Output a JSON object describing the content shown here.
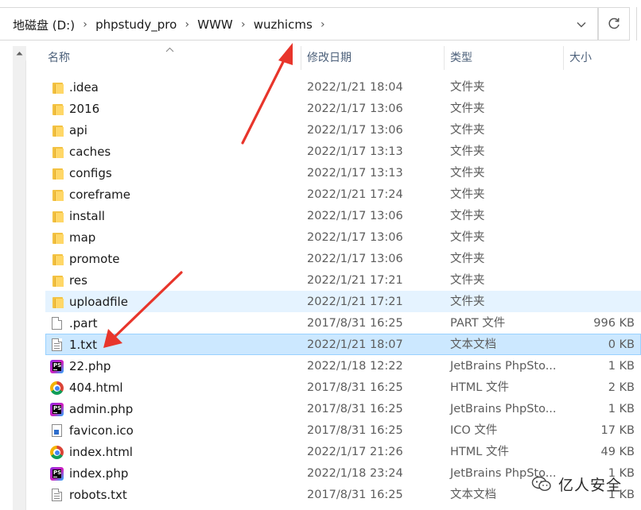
{
  "address_bar": {
    "crumbs": [
      "地磁盘 (D:)",
      "phpstudy_pro",
      "WWW",
      "wuzhicms"
    ],
    "separator": "›",
    "dropdown_icon": "chevron-down-icon",
    "refresh_icon": "refresh-icon"
  },
  "columns": {
    "name": "名称",
    "date": "修改日期",
    "type": "类型",
    "size": "大小"
  },
  "files": [
    {
      "name": ".idea",
      "date": "2022/1/21 18:04",
      "type": "文件夹",
      "size": "",
      "icon": "folder-icon"
    },
    {
      "name": "2016",
      "date": "2022/1/17 13:06",
      "type": "文件夹",
      "size": "",
      "icon": "folder-icon"
    },
    {
      "name": "api",
      "date": "2022/1/17 13:06",
      "type": "文件夹",
      "size": "",
      "icon": "folder-icon"
    },
    {
      "name": "caches",
      "date": "2022/1/17 13:13",
      "type": "文件夹",
      "size": "",
      "icon": "folder-icon"
    },
    {
      "name": "configs",
      "date": "2022/1/17 13:13",
      "type": "文件夹",
      "size": "",
      "icon": "folder-icon"
    },
    {
      "name": "coreframe",
      "date": "2022/1/21 17:24",
      "type": "文件夹",
      "size": "",
      "icon": "folder-icon"
    },
    {
      "name": "install",
      "date": "2022/1/17 13:06",
      "type": "文件夹",
      "size": "",
      "icon": "folder-icon"
    },
    {
      "name": "map",
      "date": "2022/1/17 13:06",
      "type": "文件夹",
      "size": "",
      "icon": "folder-icon"
    },
    {
      "name": "promote",
      "date": "2022/1/17 13:06",
      "type": "文件夹",
      "size": "",
      "icon": "folder-icon"
    },
    {
      "name": "res",
      "date": "2022/1/21 17:21",
      "type": "文件夹",
      "size": "",
      "icon": "folder-icon"
    },
    {
      "name": "uploadfile",
      "date": "2022/1/21 17:21",
      "type": "文件夹",
      "size": "",
      "icon": "folder-icon",
      "state": "hover"
    },
    {
      "name": ".part",
      "date": "2017/8/31 16:25",
      "type": "PART 文件",
      "size": "996 KB",
      "icon": "blank-file-icon"
    },
    {
      "name": "1.txt",
      "date": "2022/1/21 18:07",
      "type": "文本文档",
      "size": "0 KB",
      "icon": "text-file-icon",
      "state": "selected"
    },
    {
      "name": "22.php",
      "date": "2022/1/18 12:22",
      "type": "JetBrains PhpSto...",
      "size": "1 KB",
      "icon": "phpstorm-icon"
    },
    {
      "name": "404.html",
      "date": "2017/8/31 16:25",
      "type": "HTML 文件",
      "size": "2 KB",
      "icon": "chrome-icon"
    },
    {
      "name": "admin.php",
      "date": "2017/8/31 16:25",
      "type": "JetBrains PhpSto...",
      "size": "1 KB",
      "icon": "phpstorm-icon"
    },
    {
      "name": "favicon.ico",
      "date": "2017/8/31 16:25",
      "type": "ICO 文件",
      "size": "17 KB",
      "icon": "ico-file-icon"
    },
    {
      "name": "index.html",
      "date": "2022/1/17 21:26",
      "type": "HTML 文件",
      "size": "49 KB",
      "icon": "chrome-icon"
    },
    {
      "name": "index.php",
      "date": "2022/1/18 23:24",
      "type": "JetBrains PhpSto...",
      "size": "1 KB",
      "icon": "phpstorm-icon"
    },
    {
      "name": "robots.txt",
      "date": "2017/8/31 16:25",
      "type": "文本文档",
      "size": "1 KB",
      "icon": "text-file-icon"
    }
  ],
  "watermark": {
    "text": "亿人安全",
    "icon": "wechat-icon"
  },
  "colors": {
    "arrow": "#e8352b",
    "selected_bg": "#cce8ff",
    "selected_border": "#99d1ff",
    "hover_bg": "#e5f3ff",
    "header_text": "#4c607a"
  }
}
